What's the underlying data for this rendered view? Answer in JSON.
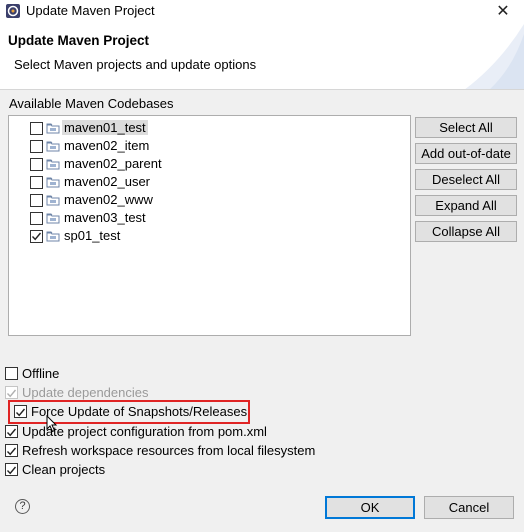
{
  "window": {
    "title": "Update Maven Project",
    "close_glyph": "✕"
  },
  "header": {
    "title": "Update Maven Project",
    "description": "Select Maven projects and update options"
  },
  "codebases": {
    "label": "Available Maven Codebases",
    "items": [
      {
        "name": "maven01_test",
        "checked": false,
        "selected": true
      },
      {
        "name": "maven02_item",
        "checked": false,
        "selected": false
      },
      {
        "name": "maven02_parent",
        "checked": false,
        "selected": false
      },
      {
        "name": "maven02_user",
        "checked": false,
        "selected": false
      },
      {
        "name": "maven02_www",
        "checked": false,
        "selected": false
      },
      {
        "name": "maven03_test",
        "checked": false,
        "selected": false
      },
      {
        "name": "sp01_test",
        "checked": true,
        "selected": false
      }
    ]
  },
  "side_buttons": {
    "select_all": "Select All",
    "add_out_of_date": "Add out-of-date",
    "deselect_all": "Deselect All",
    "expand_all": "Expand All",
    "collapse_all": "Collapse All"
  },
  "options": {
    "offline": {
      "label": "Offline",
      "checked": false,
      "disabled": false
    },
    "update_dependencies": {
      "label": "Update dependencies",
      "checked": true,
      "disabled": true
    },
    "force_update": {
      "label": "Force Update of Snapshots/Releases",
      "checked": true,
      "disabled": false
    },
    "update_config": {
      "label": "Update project configuration from pom.xml",
      "checked": true,
      "disabled": false
    },
    "refresh_workspace": {
      "label": "Refresh workspace resources from local filesystem",
      "checked": true,
      "disabled": false
    },
    "clean_projects": {
      "label": "Clean projects",
      "checked": true,
      "disabled": false
    }
  },
  "footer": {
    "help_glyph": "?",
    "ok_label": "OK",
    "cancel_label": "Cancel"
  },
  "colors": {
    "highlight": "#e02424",
    "default_button_border": "#0078d7"
  },
  "icons": {
    "app": "maven-window-icon",
    "project": "maven-project-folder-icon",
    "help": "help-icon",
    "close": "close-icon"
  }
}
